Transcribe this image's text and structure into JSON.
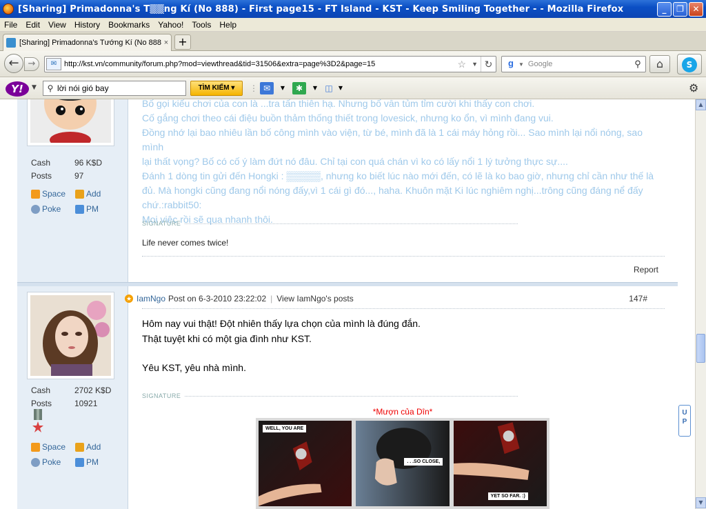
{
  "window": {
    "title": "[Sharing] Primadonna's T▒▒ng Kí (No 888) - First page15 - FT Island - KST - Keep Smiling Together - - Mozilla Firefox",
    "minimize": "_",
    "maximize": "❐",
    "close": "✕"
  },
  "menu": [
    "File",
    "Edit",
    "View",
    "History",
    "Bookmarks",
    "Yahoo!",
    "Tools",
    "Help"
  ],
  "tab": {
    "label": "[Sharing] Primadonna's Tướng Kí (No 888) - ...",
    "close": "×",
    "new": "+"
  },
  "nav": {
    "url": "http://kst.vn/community/forum.php?mod=viewthread&tid=31506&extra=page%3D2&page=15",
    "search_placeholder": "Google"
  },
  "yahoo": {
    "search_value": "lời nói gió bay",
    "search_button": "TÌM KIẾM ▾"
  },
  "post1": {
    "cash_label": "Cash",
    "cash_value": "96 K$D",
    "posts_label": "Posts",
    "posts_value": "97",
    "space": "Space",
    "add": "Add",
    "poke": "Poke",
    "pm": "PM",
    "lines": [
      "Bố gọi kiểu chơi của con là ...tra tấn thiên hạ. Nhưng bố vẫn tủm tỉm cười khi thấy con chơi.",
      "Cố gắng chơi theo cái điệu buồn thảm thống thiết trong lovesick, nhưng ko ổn, vì mình đang vui.",
      "Đồng nhớ lại bao nhiêu lần bố công mình vào viện, từ bé, mình đã là 1 cái máy hỏng rồi... Sao mình lại nổi nóng, sao mình",
      "lại thất vọng? Bố có cố ý làm đứt nó đâu. Chỉ tại con quá chán vì ko có lấy nổi 1 lý tưởng thực sự....",
      "Đánh 1 dòng tin gửi đến Hongki : ▒▒▒▒▒, nhưng ko biết lúc nào mới đến, có lẽ là ko bao giờ, nhưng chỉ cần như thế là",
      "đủ. Mà hongki cũng đang nổi nóng đấy,vì 1 cái gì đó..., haha. Khuôn mặt Ki lúc nghiêm nghị...trông cũng đáng nể đấy",
      "chứ.:rabbit50:",
      "Mọi việc rồi sẽ qua nhanh thôi."
    ],
    "signature_label": "SIGNATURE",
    "signature": "Life never comes twice!",
    "report": "Report"
  },
  "post2": {
    "author": "IamNgo",
    "posted": "Post on 6-3-2010 23:22:02",
    "view_posts": "View IamNgo's posts",
    "number": "147#",
    "cash_label": "Cash",
    "cash_value": "2702 K$D",
    "posts_label": "Posts",
    "posts_value": "10921",
    "space": "Space",
    "add": "Add",
    "poke": "Poke",
    "pm": "PM",
    "lines": [
      "Hôm nay vui thật! Đột nhiên thấy lựa chọn của mình là đúng đắn.",
      "Thật tuyệt khi có một gia đình như KST.",
      "",
      "Yêu KST, yêu nhà mình."
    ],
    "signature_label": "SIGNATURE",
    "comic_title": "*Mượn của Dîn*",
    "comic_caps": [
      "WELL, YOU ARE",
      ". . .SO CLOSE,",
      "YET SO FAR. :)"
    ]
  },
  "up_widget": "U\nP"
}
